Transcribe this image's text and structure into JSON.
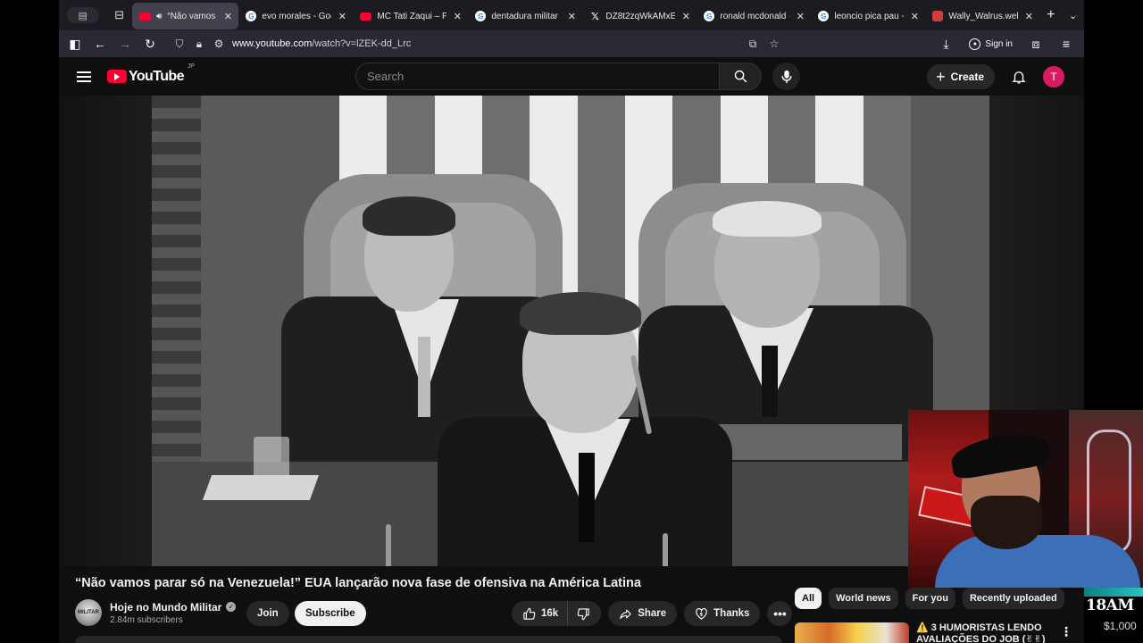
{
  "browser": {
    "tabs": [
      {
        "label": "“Não vamos p",
        "favicon": "youtube",
        "active": true,
        "playing_audio": true
      },
      {
        "label": "evo morales - Goo",
        "favicon": "google"
      },
      {
        "label": "MC Tati Zaqui – Pa",
        "favicon": "youtube"
      },
      {
        "label": "dentadura militar -",
        "favicon": "google"
      },
      {
        "label": "DZ8t2zqWkAMxEs",
        "favicon": "x"
      },
      {
        "label": "ronald mcdonald -",
        "favicon": "google"
      },
      {
        "label": "leoncio pica pau -",
        "favicon": "google"
      },
      {
        "label": "Wally_Walrus.webp",
        "favicon": "image"
      }
    ],
    "url_host": "www.youtube.com",
    "url_path": "/watch?v=lZEK-dd_Lrc",
    "sign_in_label": "Sign in"
  },
  "youtube": {
    "logo_text": "YouTube",
    "country_code": "JP",
    "search_placeholder": "Search",
    "create_label": "Create",
    "avatar_letter": "T"
  },
  "video": {
    "title": "“Não vamos parar só na Venezuela!” EUA lançarão nova fase de ofensiva na América Latina",
    "channel_name": "Hoje no Mundo Militar",
    "channel_avatar_text": "MILITAR",
    "subscribers": "2.84m subscribers",
    "join_label": "Join",
    "subscribe_label": "Subscribe",
    "likes": "16k",
    "share_label": "Share",
    "thanks_label": "Thanks"
  },
  "sidebar": {
    "chips": [
      "All",
      "World news",
      "For you",
      "Recently uploaded"
    ],
    "active_chip": "All",
    "recommendation_title": "⚠️ 3 HUMORISTAS LENDO AVALIAÇÕES DO JOB (✌︎✌︎) ⚠️"
  },
  "overlay": {
    "clock_text": "18AM",
    "money_text": "$1,000"
  },
  "colors": {
    "youtube_red": "#ff0033",
    "avatar_bg": "#d81b60",
    "page_bg": "#0f0f0f"
  }
}
